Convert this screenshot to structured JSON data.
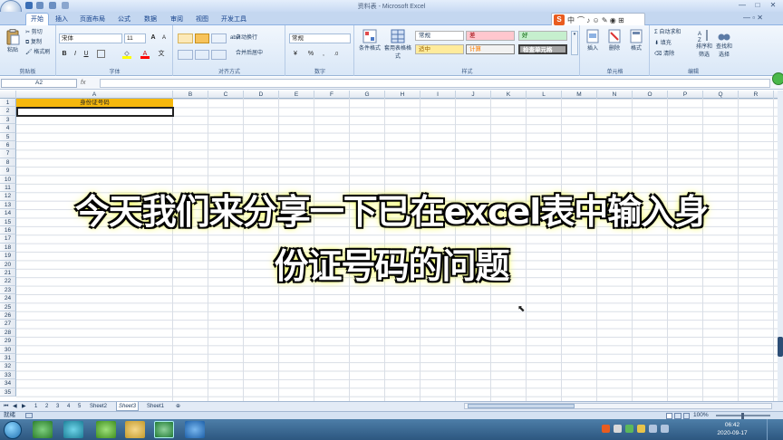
{
  "window": {
    "title": "资料表 - Microsoft Excel",
    "controls": [
      "—",
      "□",
      "✕"
    ]
  },
  "tabs": [
    "开始",
    "插入",
    "页面布局",
    "公式",
    "数据",
    "审阅",
    "视图",
    "开发工具"
  ],
  "ime": {
    "label": "中",
    "extra": "⌒ ♪ ☺ ✎ ◉ ⊞"
  },
  "ribbon": {
    "clipboard": {
      "paste": "粘贴",
      "cut": "剪切",
      "copy": "复制",
      "format_painter": "格式刷",
      "label": "剪贴板"
    },
    "font": {
      "name": "宋体",
      "size": "11",
      "bold": "B",
      "italic": "I",
      "underline": "U",
      "label": "字体",
      "grow": "A",
      "shrink": "A"
    },
    "alignment": {
      "wrap": "自动换行",
      "merge": "合并后居中",
      "label": "对齐方式"
    },
    "number": {
      "format": "常规",
      "label": "数字",
      "percent": "%",
      "comma": ","
    },
    "styles": {
      "conditional": "条件格式",
      "table": "套用表格格式",
      "normal": "常规",
      "bad": "差",
      "good": "好",
      "neutral": "适中",
      "calc": "计算",
      "check": "检查单元格",
      "label": "样式"
    },
    "cells": {
      "insert": "插入",
      "delete": "删除",
      "format": "格式",
      "label": "单元格"
    },
    "editing": {
      "autosum": "Σ 自动求和",
      "fill": "填充",
      "clear": "清除",
      "sort": "排序和筛选",
      "find": "查找和选择",
      "label": "编辑"
    }
  },
  "formula_bar": {
    "name_box": "A2",
    "fx": "fx",
    "content": ""
  },
  "columns": [
    "A",
    "B",
    "C",
    "D",
    "E",
    "F",
    "G",
    "H",
    "I",
    "J",
    "K",
    "L",
    "M",
    "N",
    "O",
    "P",
    "Q",
    "R"
  ],
  "rows": [
    "1",
    "2",
    "3",
    "4",
    "5",
    "6",
    "7",
    "8",
    "9",
    "10",
    "11",
    "12",
    "13",
    "14",
    "15",
    "16",
    "17",
    "18",
    "19",
    "20",
    "21",
    "22",
    "23",
    "24",
    "25",
    "26",
    "27",
    "28",
    "29",
    "30",
    "31",
    "32",
    "33",
    "34",
    "35"
  ],
  "cell_a1": "身份证号码",
  "sheets": [
    "1",
    "2",
    "3",
    "4",
    "5",
    "Sheet2",
    "Sheet3",
    "Sheet1"
  ],
  "active_sheet": "Sheet3",
  "status": {
    "mode": "就绪",
    "zoom": "100%"
  },
  "clock": {
    "time": "06:42",
    "date": "2020-09-17"
  },
  "caption": {
    "line1": "今天我们来分享一下已在excel表中输入身",
    "line2": "份证号码的问题"
  },
  "colors": {
    "a1_fill": "#f6b80d",
    "ribbon": "#dbe8f8",
    "caption_glow": "#f4ff3a"
  }
}
